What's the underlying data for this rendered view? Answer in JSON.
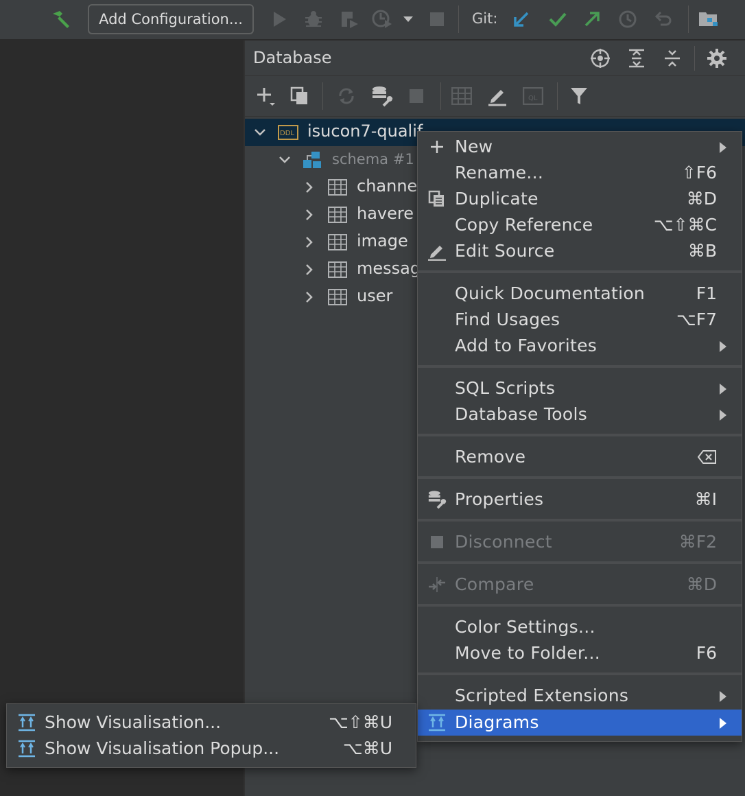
{
  "toolbar": {
    "config_label": "Add Configuration...",
    "git_label": "Git:"
  },
  "panel": {
    "title": "Database"
  },
  "tree": {
    "root": "isucon7-qualif",
    "root_badge": "DDL",
    "schema": "schema #1",
    "tables": [
      "channel",
      "havere",
      "image",
      "messag",
      "user"
    ]
  },
  "menu": {
    "items": [
      {
        "label": "New",
        "shortcut": ""
      },
      {
        "label": "Rename...",
        "shortcut": "⇧F6"
      },
      {
        "label": "Duplicate",
        "shortcut": "⌘D"
      },
      {
        "label": "Copy Reference",
        "shortcut": "⌥⇧⌘C"
      },
      {
        "label": "Edit Source",
        "shortcut": "⌘B"
      },
      {
        "label": "Quick Documentation",
        "shortcut": "F1"
      },
      {
        "label": "Find Usages",
        "shortcut": "⌥F7"
      },
      {
        "label": "Add to Favorites",
        "shortcut": ""
      },
      {
        "label": "SQL Scripts",
        "shortcut": ""
      },
      {
        "label": "Database Tools",
        "shortcut": ""
      },
      {
        "label": "Remove",
        "shortcut": ""
      },
      {
        "label": "Properties",
        "shortcut": "⌘I"
      },
      {
        "label": "Disconnect",
        "shortcut": "⌘F2"
      },
      {
        "label": "Compare",
        "shortcut": "⌘D"
      },
      {
        "label": "Color Settings...",
        "shortcut": ""
      },
      {
        "label": "Move to Folder...",
        "shortcut": "F6"
      },
      {
        "label": "Scripted Extensions",
        "shortcut": ""
      },
      {
        "label": "Diagrams",
        "shortcut": ""
      }
    ]
  },
  "submenu": {
    "items": [
      {
        "label": "Show Visualisation...",
        "shortcut": "⌥⇧⌘U"
      },
      {
        "label": "Show Visualisation Popup...",
        "shortcut": "⌥⌘U"
      }
    ]
  },
  "colors": {
    "accent": "#2f65ca",
    "selected_row": "#0d293e",
    "git_update": "#3592c4",
    "git_commit": "#499c54"
  }
}
